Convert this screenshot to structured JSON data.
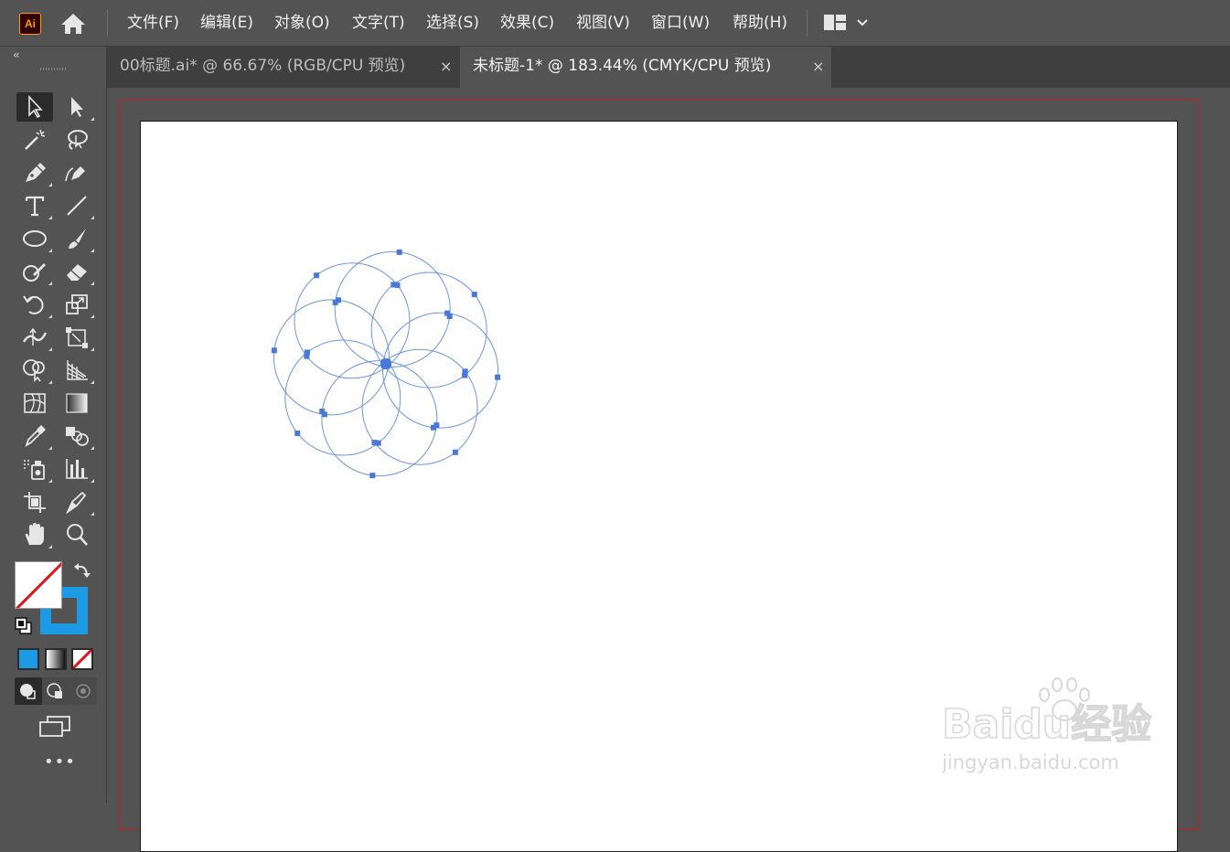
{
  "app": {
    "logo_text": "Ai"
  },
  "menu": {
    "items": [
      {
        "label": "文件(F)"
      },
      {
        "label": "编辑(E)"
      },
      {
        "label": "对象(O)"
      },
      {
        "label": "文字(T)"
      },
      {
        "label": "选择(S)"
      },
      {
        "label": "效果(C)"
      },
      {
        "label": "视图(V)"
      },
      {
        "label": "窗口(W)"
      },
      {
        "label": "帮助(H)"
      }
    ]
  },
  "tabs": [
    {
      "label": "00标题.ai* @ 66.67% (RGB/CPU 预览)",
      "active": false,
      "close": "×"
    },
    {
      "label": "未标题-1* @ 183.44% (CMYK/CPU 预览)",
      "active": true,
      "close": "×"
    }
  ],
  "toolbar": {
    "collapse_label": "‹‹",
    "more_label": "•••",
    "tools": [
      {
        "name": "selection-tool",
        "icon": "selection-arrow-icon",
        "selected": true
      },
      {
        "name": "direct-selection-tool",
        "icon": "direct-selection-icon"
      },
      {
        "name": "magic-wand-tool",
        "icon": "magic-wand-icon"
      },
      {
        "name": "lasso-tool",
        "icon": "lasso-icon"
      },
      {
        "name": "pen-tool",
        "icon": "pen-icon"
      },
      {
        "name": "curvature-tool",
        "icon": "curvature-icon"
      },
      {
        "name": "type-tool",
        "icon": "type-icon"
      },
      {
        "name": "line-segment-tool",
        "icon": "line-icon"
      },
      {
        "name": "ellipse-tool",
        "icon": "ellipse-icon"
      },
      {
        "name": "paintbrush-tool",
        "icon": "paintbrush-icon"
      },
      {
        "name": "shaper-tool",
        "icon": "shaper-icon"
      },
      {
        "name": "eraser-tool",
        "icon": "eraser-icon"
      },
      {
        "name": "rotate-tool",
        "icon": "rotate-icon"
      },
      {
        "name": "scale-tool",
        "icon": "scale-icon"
      },
      {
        "name": "width-tool",
        "icon": "width-icon"
      },
      {
        "name": "free-transform-tool",
        "icon": "free-transform-icon"
      },
      {
        "name": "shape-builder-tool",
        "icon": "shape-builder-icon"
      },
      {
        "name": "perspective-grid-tool",
        "icon": "perspective-grid-icon"
      },
      {
        "name": "mesh-tool",
        "icon": "mesh-icon"
      },
      {
        "name": "gradient-tool",
        "icon": "gradient-icon"
      },
      {
        "name": "eyedropper-tool",
        "icon": "eyedropper-icon"
      },
      {
        "name": "blend-tool",
        "icon": "blend-icon"
      },
      {
        "name": "symbol-sprayer-tool",
        "icon": "symbol-sprayer-icon"
      },
      {
        "name": "column-graph-tool",
        "icon": "column-graph-icon"
      },
      {
        "name": "artboard-tool",
        "icon": "artboard-icon"
      },
      {
        "name": "slice-tool",
        "icon": "slice-icon"
      },
      {
        "name": "hand-tool",
        "icon": "hand-icon"
      },
      {
        "name": "zoom-tool",
        "icon": "zoom-icon"
      }
    ]
  },
  "colors": {
    "fill": "none",
    "stroke": "#1c9ae4",
    "path_stroke": "#6b95e0",
    "anchor": "#4a78d8",
    "guide": "#c41f1f",
    "artboard": "#ffffff",
    "ui_bg": "#535353"
  },
  "watermark": {
    "brand": "Baidu经验",
    "url": "jingyan.baidu.com"
  }
}
